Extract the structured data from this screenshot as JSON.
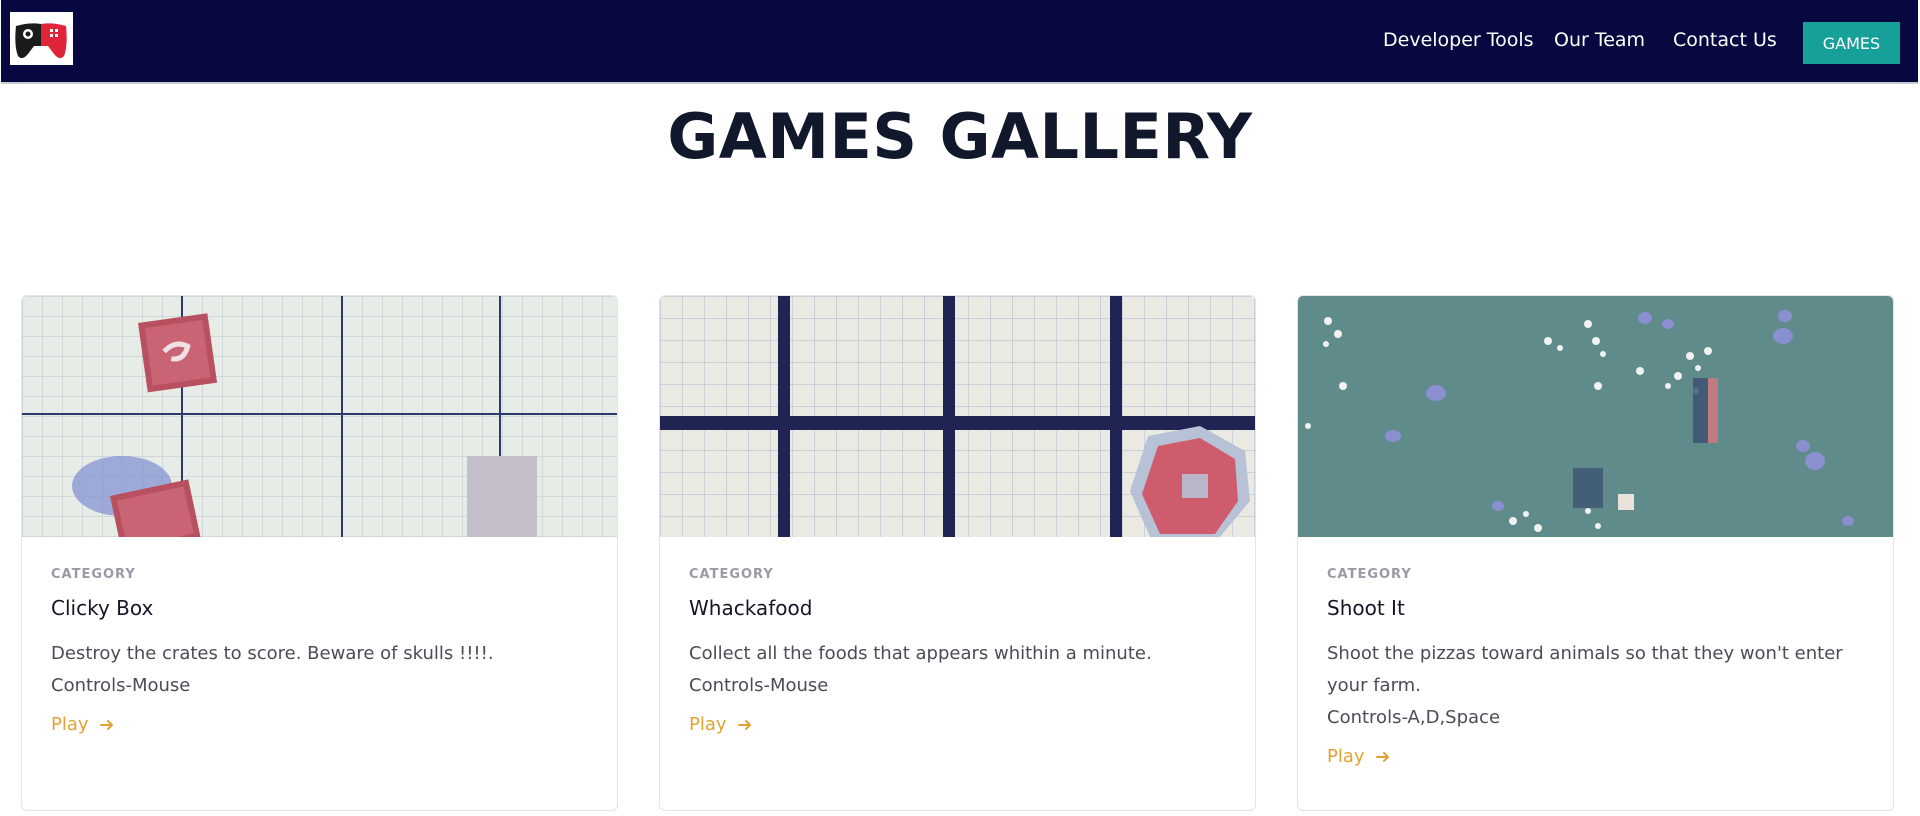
{
  "nav": {
    "logo": "gamepad-logo-icon",
    "links": [
      "Developer Tools",
      "Our Team",
      "Contact Us"
    ],
    "games_button": "GAMES"
  },
  "page": {
    "title": "GAMES GALLERY"
  },
  "cards": [
    {
      "category": "CATEGORY",
      "title": "Clicky Box",
      "description": "Destroy the crates to score. Beware of skulls !!!!.",
      "controls": "Controls-Mouse",
      "play": "Play"
    },
    {
      "category": "CATEGORY",
      "title": "Whackafood",
      "description": "Collect all the foods that appears whithin a minute.",
      "controls": "Controls-Mouse",
      "play": "Play"
    },
    {
      "category": "CATEGORY",
      "title": "Shoot It",
      "description": "Shoot the pizzas toward animals so that they won't enter your farm.",
      "controls": "Controls-A,D,Space",
      "play": "Play"
    }
  ],
  "colors": {
    "navbar": "#06083f",
    "accent": "#17a09a",
    "play_link": "#e2a233"
  }
}
